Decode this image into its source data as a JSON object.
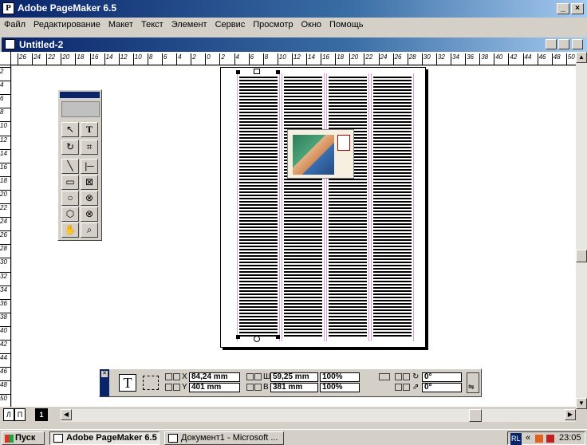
{
  "app": {
    "title": "Adobe PageMaker 6.5",
    "app_icon_letter": "P",
    "window_buttons": [
      "_",
      "×"
    ]
  },
  "menubar": {
    "items": [
      "Файл",
      "Редактирование",
      "Макет",
      "Текст",
      "Элемент",
      "Сервис",
      "Просмотр",
      "Окно",
      "Помощь"
    ]
  },
  "document": {
    "title": "Untitled-2"
  },
  "rulers": {
    "horizontal_ticks": [
      "26",
      "24",
      "22",
      "20",
      "18",
      "16",
      "14",
      "12",
      "10",
      "8",
      "6",
      "4",
      "2",
      "0",
      "2",
      "4",
      "6",
      "8",
      "10",
      "12",
      "14",
      "16",
      "18",
      "20",
      "22",
      "24",
      "26",
      "28",
      "30",
      "32",
      "34",
      "36",
      "38",
      "40",
      "42",
      "44",
      "46",
      "48",
      "50"
    ],
    "vertical_ticks": [
      "2",
      "4",
      "6",
      "8",
      "10",
      "12",
      "14",
      "16",
      "18",
      "20",
      "22",
      "24",
      "26",
      "28",
      "30",
      "32",
      "34",
      "36",
      "38",
      "40",
      "42",
      "44",
      "46",
      "48",
      "50"
    ]
  },
  "toolbox": {
    "tools": [
      {
        "name": "pointer",
        "glyph": "↖"
      },
      {
        "name": "text",
        "glyph": "T"
      },
      {
        "name": "rotate",
        "glyph": "↻"
      },
      {
        "name": "crop",
        "glyph": "⌗"
      },
      {
        "name": "line",
        "glyph": "╲"
      },
      {
        "name": "constrained-line",
        "glyph": "|─"
      },
      {
        "name": "rectangle",
        "glyph": "▭"
      },
      {
        "name": "rectangle-frame",
        "glyph": "⊠"
      },
      {
        "name": "ellipse",
        "glyph": "○"
      },
      {
        "name": "ellipse-frame",
        "glyph": "⊗"
      },
      {
        "name": "polygon",
        "glyph": "⬡"
      },
      {
        "name": "polygon-frame",
        "glyph": "⊗"
      },
      {
        "name": "hand",
        "glyph": "✋"
      },
      {
        "name": "zoom",
        "glyph": "⌕"
      }
    ]
  },
  "control_palette": {
    "x_label": "X",
    "x_value": "84,24 mm",
    "y_label": "Y",
    "y_value": "401 mm",
    "w_label": "Ш",
    "w_value": "59,25 mm",
    "h_label": "В",
    "h_value": "381 mm",
    "scale_x": "100%",
    "scale_y": "100%",
    "rotation": "0°",
    "skew": "0°",
    "text_tool_glyph": "T"
  },
  "page_icons": {
    "left": "Л",
    "right": "П",
    "page_number": "1"
  },
  "taskbar": {
    "start_label": "Пуск",
    "items": [
      "Adobe PageMaker 6.5",
      "Документ1 - Microsoft ..."
    ],
    "tray_lang": "RL",
    "tray_arrows": "«",
    "clock": "23:05"
  }
}
